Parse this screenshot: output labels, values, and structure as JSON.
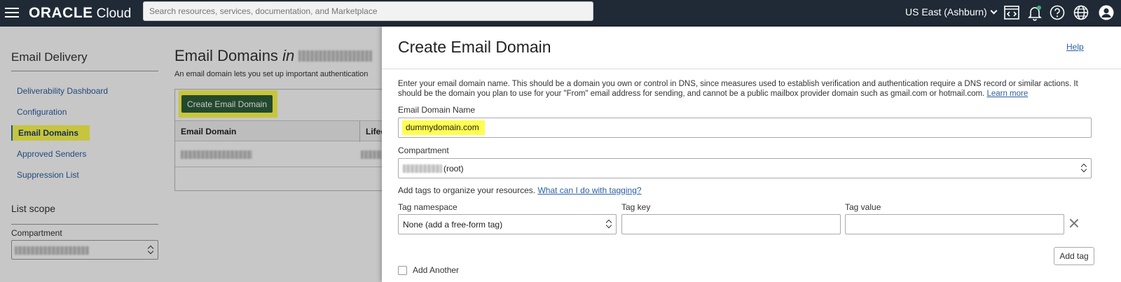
{
  "topbar": {
    "brand": "ORACLE",
    "product": "Cloud",
    "search_placeholder": "Search resources, services, documentation, and Marketplace",
    "region": "US East (Ashburn)",
    "icons": [
      "menu-icon",
      "code-editor-icon",
      "bell-icon",
      "help-icon",
      "globe-icon",
      "user-icon"
    ],
    "notification_dot_color": "#3fb27f"
  },
  "sidebar": {
    "title": "Email Delivery",
    "items": [
      {
        "label": "Deliverability Dashboard"
      },
      {
        "label": "Configuration"
      },
      {
        "label": "Email Domains",
        "active": true
      },
      {
        "label": "Approved Senders"
      },
      {
        "label": "Suppression List"
      }
    ],
    "scope_title": "List scope",
    "compartment_label": "Compartment"
  },
  "main": {
    "title": "Email Domains",
    "title_suffix": "in",
    "description": "An email domain lets you set up important authentication",
    "create_button": "Create Email Domain",
    "columns": [
      "Email Domain",
      "Lifec"
    ]
  },
  "dialog": {
    "title": "Create Email Domain",
    "help": "Help",
    "intro": "Enter your email domain name. This should be a domain you own or control in DNS, since measures used to establish verification and authentication require a DNS record or similar actions. It should be the domain you plan to use for your \"From\" email address for sending, and cannot be a public mailbox provider domain such as gmail.com or hotmail.com.",
    "learn_more": "Learn more",
    "domain_label": "Email Domain Name",
    "domain_value": "dummydomain.com",
    "compartment_label": "Compartment",
    "compartment_value": "(root)",
    "tags_help": "Add tags to organize your resources.",
    "tags_link": "What can I do with tagging?",
    "tag_namespace_label": "Tag namespace",
    "tag_namespace_value": "None (add a free-form tag)",
    "tag_key_label": "Tag key",
    "tag_key_value": "",
    "tag_value_label": "Tag value",
    "tag_value_value": "",
    "add_tag": "Add tag",
    "add_another": "Add Another"
  },
  "colors": {
    "topbar_bg": "#1f2a36",
    "highlight": "#fffd50",
    "primary_button": "#2e5e3a",
    "link": "#2c5fa3"
  }
}
